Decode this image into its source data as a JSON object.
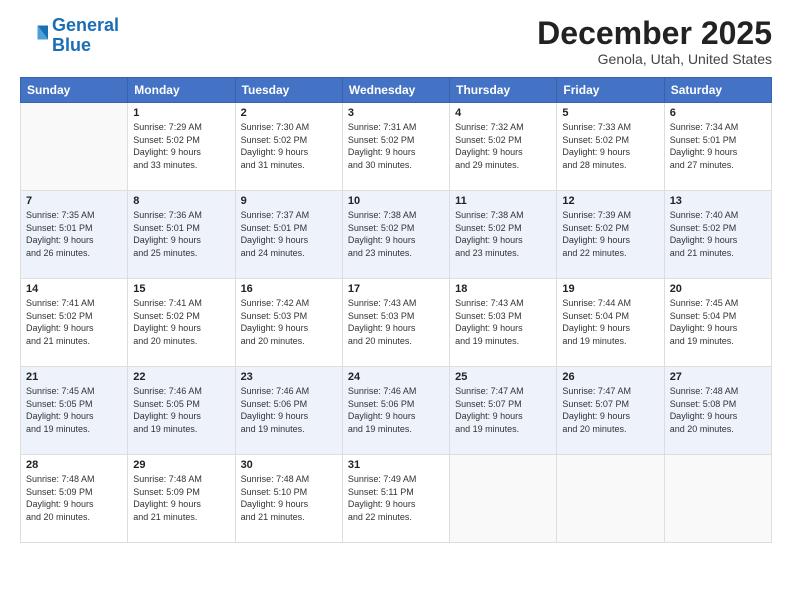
{
  "header": {
    "logo_line1": "General",
    "logo_line2": "Blue",
    "month_title": "December 2025",
    "location": "Genola, Utah, United States"
  },
  "weekdays": [
    "Sunday",
    "Monday",
    "Tuesday",
    "Wednesday",
    "Thursday",
    "Friday",
    "Saturday"
  ],
  "weeks": [
    [
      {
        "day": "",
        "info": ""
      },
      {
        "day": "1",
        "info": "Sunrise: 7:29 AM\nSunset: 5:02 PM\nDaylight: 9 hours\nand 33 minutes."
      },
      {
        "day": "2",
        "info": "Sunrise: 7:30 AM\nSunset: 5:02 PM\nDaylight: 9 hours\nand 31 minutes."
      },
      {
        "day": "3",
        "info": "Sunrise: 7:31 AM\nSunset: 5:02 PM\nDaylight: 9 hours\nand 30 minutes."
      },
      {
        "day": "4",
        "info": "Sunrise: 7:32 AM\nSunset: 5:02 PM\nDaylight: 9 hours\nand 29 minutes."
      },
      {
        "day": "5",
        "info": "Sunrise: 7:33 AM\nSunset: 5:02 PM\nDaylight: 9 hours\nand 28 minutes."
      },
      {
        "day": "6",
        "info": "Sunrise: 7:34 AM\nSunset: 5:01 PM\nDaylight: 9 hours\nand 27 minutes."
      }
    ],
    [
      {
        "day": "7",
        "info": "Sunrise: 7:35 AM\nSunset: 5:01 PM\nDaylight: 9 hours\nand 26 minutes."
      },
      {
        "day": "8",
        "info": "Sunrise: 7:36 AM\nSunset: 5:01 PM\nDaylight: 9 hours\nand 25 minutes."
      },
      {
        "day": "9",
        "info": "Sunrise: 7:37 AM\nSunset: 5:01 PM\nDaylight: 9 hours\nand 24 minutes."
      },
      {
        "day": "10",
        "info": "Sunrise: 7:38 AM\nSunset: 5:02 PM\nDaylight: 9 hours\nand 23 minutes."
      },
      {
        "day": "11",
        "info": "Sunrise: 7:38 AM\nSunset: 5:02 PM\nDaylight: 9 hours\nand 23 minutes."
      },
      {
        "day": "12",
        "info": "Sunrise: 7:39 AM\nSunset: 5:02 PM\nDaylight: 9 hours\nand 22 minutes."
      },
      {
        "day": "13",
        "info": "Sunrise: 7:40 AM\nSunset: 5:02 PM\nDaylight: 9 hours\nand 21 minutes."
      }
    ],
    [
      {
        "day": "14",
        "info": "Sunrise: 7:41 AM\nSunset: 5:02 PM\nDaylight: 9 hours\nand 21 minutes."
      },
      {
        "day": "15",
        "info": "Sunrise: 7:41 AM\nSunset: 5:02 PM\nDaylight: 9 hours\nand 20 minutes."
      },
      {
        "day": "16",
        "info": "Sunrise: 7:42 AM\nSunset: 5:03 PM\nDaylight: 9 hours\nand 20 minutes."
      },
      {
        "day": "17",
        "info": "Sunrise: 7:43 AM\nSunset: 5:03 PM\nDaylight: 9 hours\nand 20 minutes."
      },
      {
        "day": "18",
        "info": "Sunrise: 7:43 AM\nSunset: 5:03 PM\nDaylight: 9 hours\nand 19 minutes."
      },
      {
        "day": "19",
        "info": "Sunrise: 7:44 AM\nSunset: 5:04 PM\nDaylight: 9 hours\nand 19 minutes."
      },
      {
        "day": "20",
        "info": "Sunrise: 7:45 AM\nSunset: 5:04 PM\nDaylight: 9 hours\nand 19 minutes."
      }
    ],
    [
      {
        "day": "21",
        "info": "Sunrise: 7:45 AM\nSunset: 5:05 PM\nDaylight: 9 hours\nand 19 minutes."
      },
      {
        "day": "22",
        "info": "Sunrise: 7:46 AM\nSunset: 5:05 PM\nDaylight: 9 hours\nand 19 minutes."
      },
      {
        "day": "23",
        "info": "Sunrise: 7:46 AM\nSunset: 5:06 PM\nDaylight: 9 hours\nand 19 minutes."
      },
      {
        "day": "24",
        "info": "Sunrise: 7:46 AM\nSunset: 5:06 PM\nDaylight: 9 hours\nand 19 minutes."
      },
      {
        "day": "25",
        "info": "Sunrise: 7:47 AM\nSunset: 5:07 PM\nDaylight: 9 hours\nand 19 minutes."
      },
      {
        "day": "26",
        "info": "Sunrise: 7:47 AM\nSunset: 5:07 PM\nDaylight: 9 hours\nand 20 minutes."
      },
      {
        "day": "27",
        "info": "Sunrise: 7:48 AM\nSunset: 5:08 PM\nDaylight: 9 hours\nand 20 minutes."
      }
    ],
    [
      {
        "day": "28",
        "info": "Sunrise: 7:48 AM\nSunset: 5:09 PM\nDaylight: 9 hours\nand 20 minutes."
      },
      {
        "day": "29",
        "info": "Sunrise: 7:48 AM\nSunset: 5:09 PM\nDaylight: 9 hours\nand 21 minutes."
      },
      {
        "day": "30",
        "info": "Sunrise: 7:48 AM\nSunset: 5:10 PM\nDaylight: 9 hours\nand 21 minutes."
      },
      {
        "day": "31",
        "info": "Sunrise: 7:49 AM\nSunset: 5:11 PM\nDaylight: 9 hours\nand 22 minutes."
      },
      {
        "day": "",
        "info": ""
      },
      {
        "day": "",
        "info": ""
      },
      {
        "day": "",
        "info": ""
      }
    ]
  ]
}
